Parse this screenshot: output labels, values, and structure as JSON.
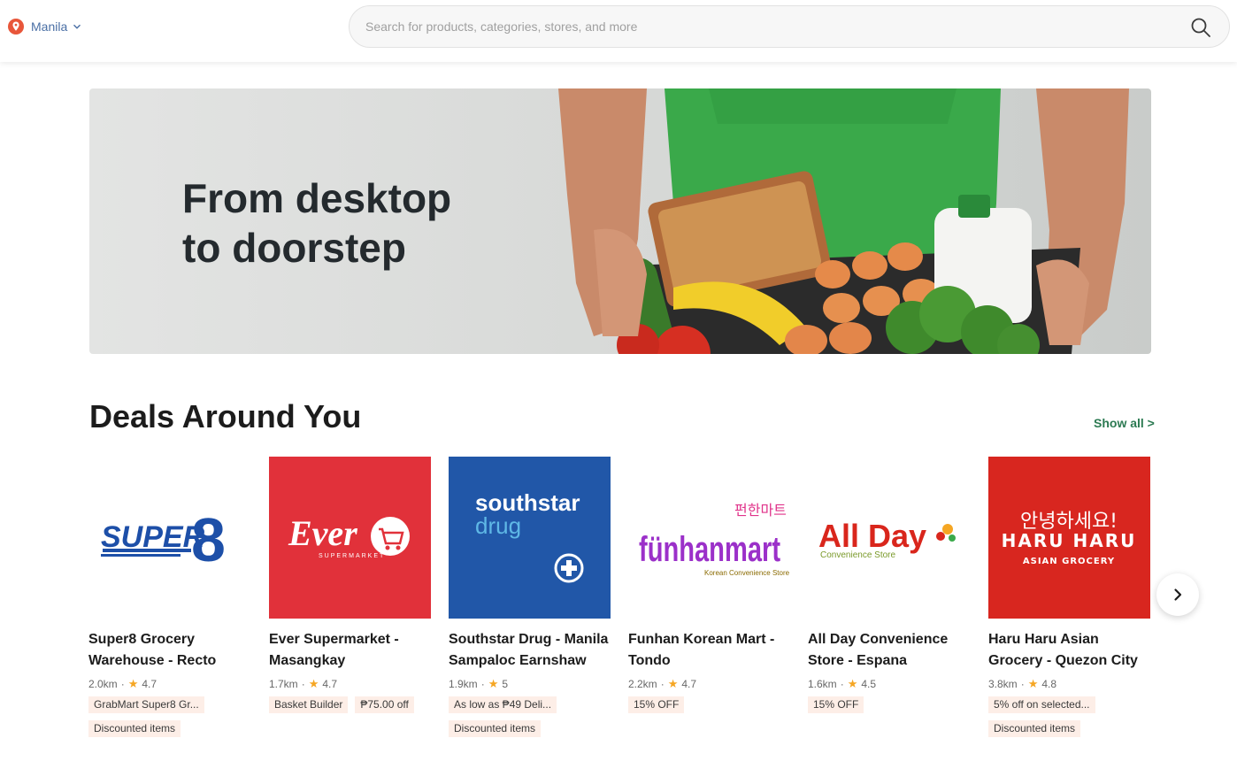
{
  "header": {
    "location": "Manila",
    "search_placeholder": "Search for products, categories, stores, and more"
  },
  "hero": {
    "title_line1": "From desktop",
    "title_line2": "to doorstep"
  },
  "deals": {
    "title": "Deals Around You",
    "show_all": "Show all >",
    "stores": [
      {
        "name": "Super8 Grocery Warehouse - Recto",
        "distance": "2.0km",
        "rating": "4.7",
        "tags": [
          "GrabMart Super8 Gr...",
          "Discounted items"
        ],
        "logo_text": "SUPER",
        "logo_number": "8"
      },
      {
        "name": "Ever Supermarket - Masangkay",
        "distance": "1.7km",
        "rating": "4.7",
        "tags": [
          "Basket Builder",
          "₱75.00 off"
        ],
        "logo_text": "Ever",
        "logo_sub": "SUPERMARKET"
      },
      {
        "name": "Southstar Drug - Manila Sampaloc Earnshaw",
        "distance": "1.9km",
        "rating": "5",
        "tags": [
          "As low as ₱49 Deli...",
          "Discounted items"
        ],
        "logo_text": "southstar",
        "logo_sub": "drug"
      },
      {
        "name": "Funhan Korean Mart - Tondo",
        "distance": "2.2km",
        "rating": "4.7",
        "tags": [
          "15% OFF"
        ],
        "logo_text": "fünhanmart",
        "logo_korean": "펀한마트",
        "logo_sub": "Korean Convenience Store"
      },
      {
        "name": "All Day Convenience Store - Espana",
        "distance": "1.6km",
        "rating": "4.5",
        "tags": [
          "15% OFF"
        ],
        "logo_text": "All Day",
        "logo_sub": "Convenience Store"
      },
      {
        "name": "Haru Haru Asian Grocery - Quezon City",
        "distance": "3.8km",
        "rating": "4.8",
        "tags": [
          "5% off on selected...",
          "Discounted items"
        ],
        "logo_korean": "안녕하세요!",
        "logo_text": "HARU HARU",
        "logo_sub": "ASIAN GROCERY"
      }
    ]
  },
  "colors": {
    "accent_green": "#2c7a52",
    "tag_bg": "#fdeee7",
    "star": "#f5a623",
    "location_pin": "#e8563a"
  },
  "icons": {
    "location": "location-pin-icon",
    "dropdown": "chevron-down-icon",
    "search": "search-icon",
    "next": "chevron-right-icon",
    "rating": "star-icon"
  }
}
